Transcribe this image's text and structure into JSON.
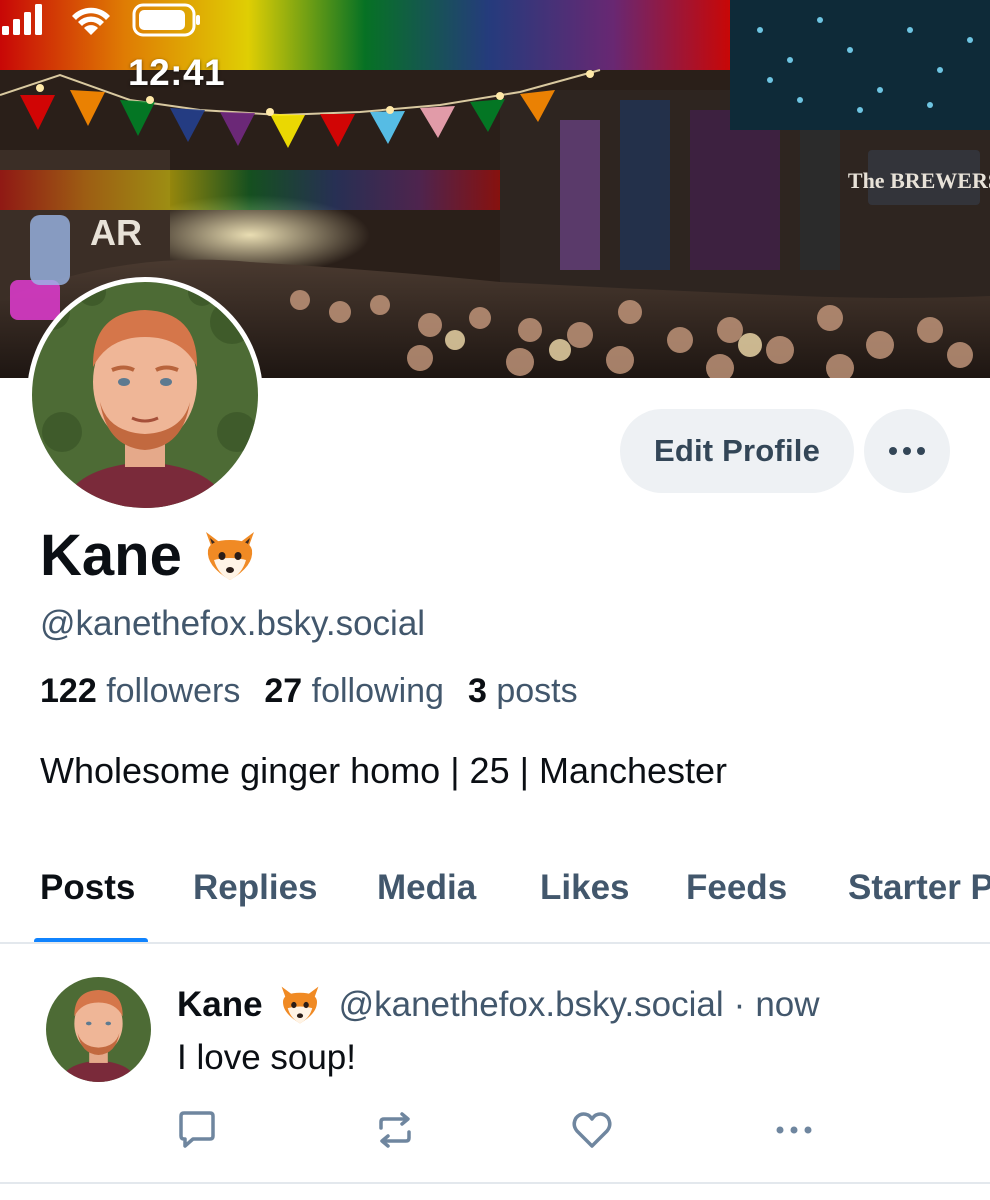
{
  "status_bar": {
    "time": "12:41"
  },
  "banner": {
    "sign_text": "The BREWERS",
    "bar_text": "AR"
  },
  "profile": {
    "display_name": "Kane",
    "handle": "@kanethefox.bsky.social",
    "bio": "Wholesome ginger homo | 25 | Manchester",
    "stats": {
      "followers_count": "122",
      "followers_label": "followers",
      "following_count": "27",
      "following_label": "following",
      "posts_count": "3",
      "posts_label": "posts"
    }
  },
  "actions": {
    "edit_label": "Edit Profile",
    "more_label": "•••"
  },
  "tabs": [
    {
      "label": "Posts",
      "active": true
    },
    {
      "label": "Replies"
    },
    {
      "label": "Media"
    },
    {
      "label": "Likes"
    },
    {
      "label": "Feeds"
    },
    {
      "label": "Starter Packs"
    }
  ],
  "post": {
    "author": "Kane",
    "handle": "@kanethefox.bsky.social",
    "separator": "·",
    "time": "now",
    "text": "I love soup!"
  },
  "icons": [
    "signal-icon",
    "wifi-icon",
    "battery-icon",
    "fox-emoji-icon",
    "reply-icon",
    "repost-icon",
    "like-icon",
    "more-icon"
  ],
  "colors": {
    "accent": "#1083fe",
    "muted_text": "#42576c",
    "button_bg": "#eef1f4",
    "text": "#0b0f14"
  }
}
